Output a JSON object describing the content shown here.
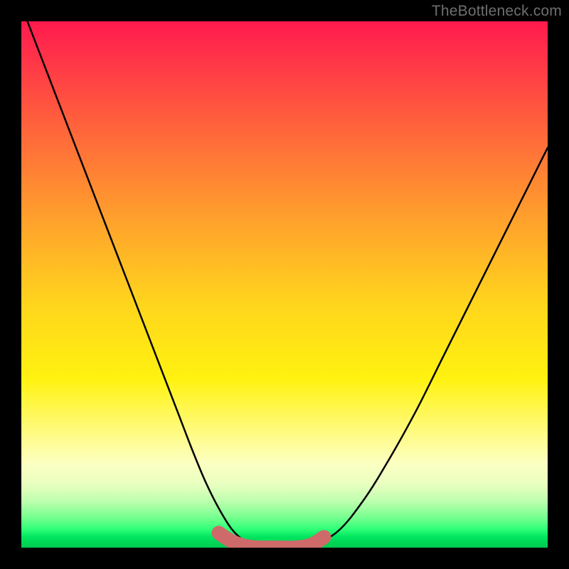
{
  "watermark": "TheBottleneck.com",
  "chart_data": {
    "type": "line",
    "title": "",
    "xlabel": "",
    "ylabel": "",
    "xlim": [
      0,
      1
    ],
    "ylim": [
      0,
      1
    ],
    "series": [
      {
        "name": "bottleneck-curve",
        "x": [
          0.0,
          0.05,
          0.1,
          0.15,
          0.2,
          0.25,
          0.3,
          0.325,
          0.35,
          0.375,
          0.4,
          0.425,
          0.45,
          0.48,
          0.52,
          0.55,
          0.6,
          0.65,
          0.7,
          0.75,
          0.8,
          0.85,
          0.9,
          0.95,
          1.0
        ],
        "y": [
          1.03,
          0.9,
          0.77,
          0.64,
          0.51,
          0.38,
          0.25,
          0.185,
          0.125,
          0.075,
          0.035,
          0.012,
          0.002,
          0.0,
          0.0,
          0.005,
          0.03,
          0.09,
          0.17,
          0.26,
          0.36,
          0.46,
          0.56,
          0.66,
          0.76
        ]
      },
      {
        "name": "bottom-marker-band",
        "x": [
          0.375,
          0.4,
          0.425,
          0.45,
          0.48,
          0.52,
          0.55,
          0.575
        ],
        "y": [
          0.028,
          0.012,
          0.003,
          0.0,
          0.0,
          0.0,
          0.005,
          0.02
        ]
      }
    ],
    "colors": {
      "curve": "#000000",
      "marker": "#cf6a6a"
    }
  }
}
